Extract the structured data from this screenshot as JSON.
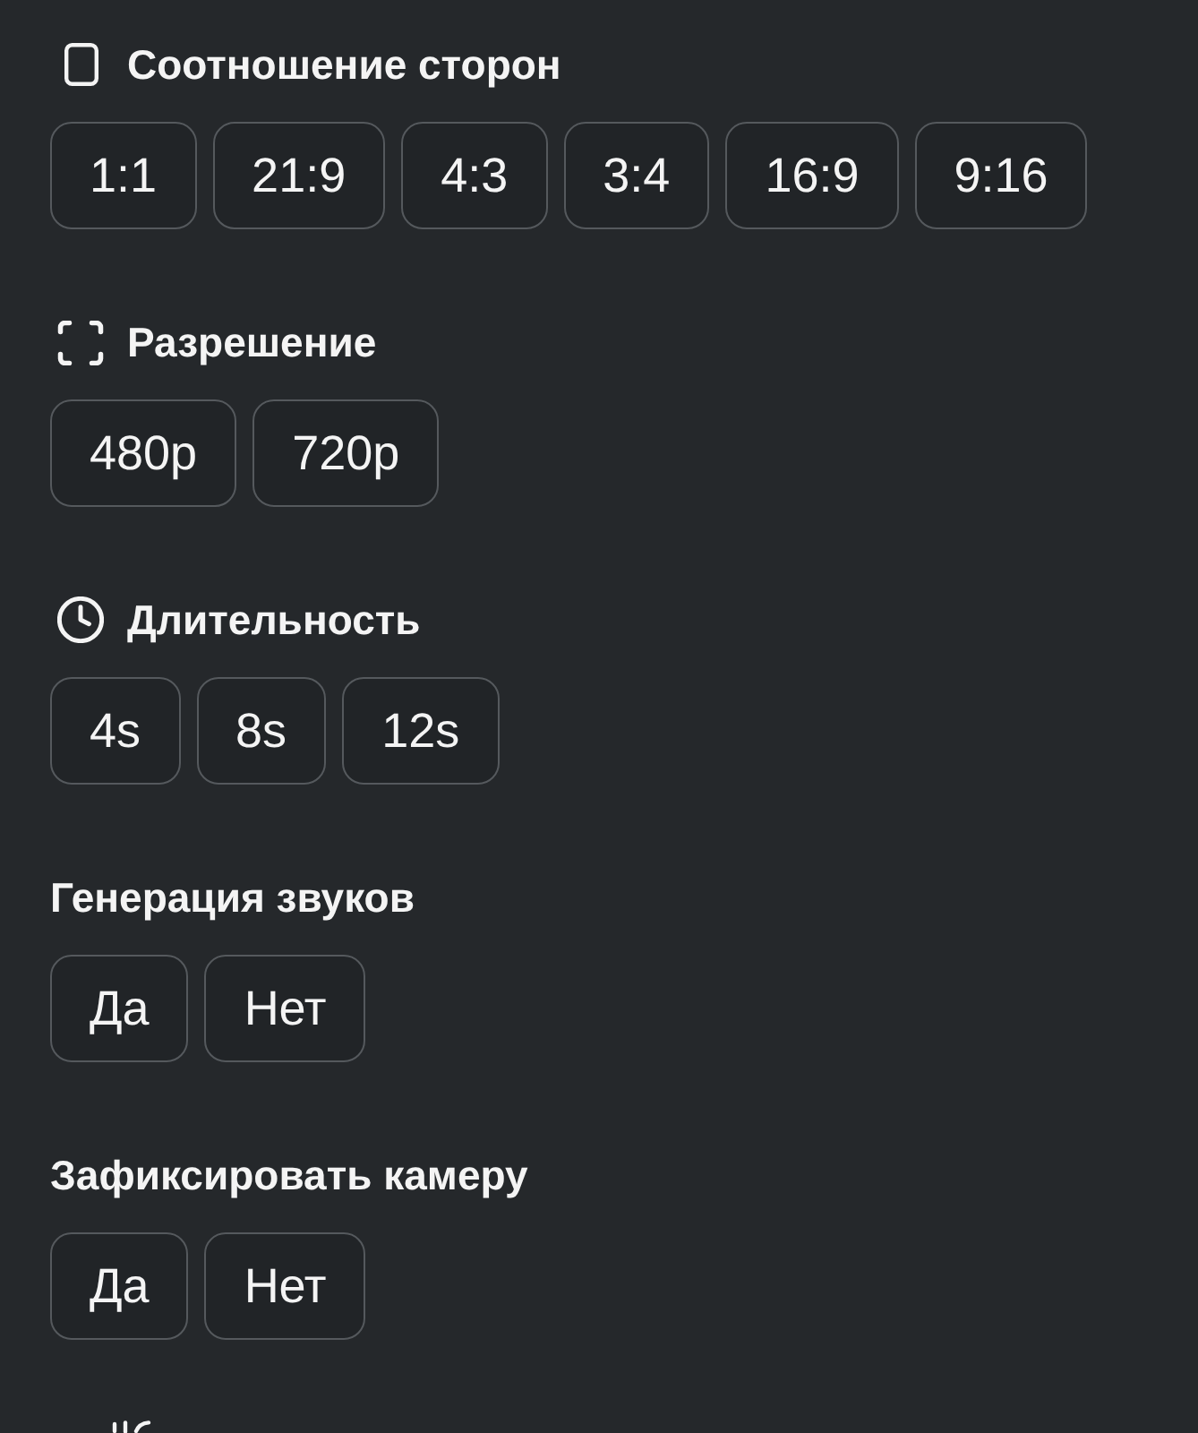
{
  "sections": [
    {
      "kind": "ratio",
      "title": "Соотношение сторон",
      "options": [
        {
          "label": "1:1"
        },
        {
          "label": "21:9"
        },
        {
          "label": "4:3"
        },
        {
          "label": "3:4"
        },
        {
          "label": "16:9"
        },
        {
          "label": "9:16"
        }
      ]
    },
    {
      "kind": "resolution",
      "title": "Разрешение",
      "options": [
        {
          "label": "480p"
        },
        {
          "label": "720p"
        }
      ]
    },
    {
      "kind": "duration",
      "title": "Длительность",
      "options": [
        {
          "label": "4s"
        },
        {
          "label": "8s"
        },
        {
          "label": "12s"
        }
      ]
    },
    {
      "kind": "plain",
      "title": "Генерация звуков",
      "options": [
        {
          "label": "Да"
        },
        {
          "label": "Нет"
        }
      ]
    },
    {
      "kind": "plain",
      "title": "Зафиксировать камеру",
      "options": [
        {
          "label": "Да"
        },
        {
          "label": "Нет"
        }
      ]
    },
    {
      "kind": "cutoff"
    }
  ]
}
